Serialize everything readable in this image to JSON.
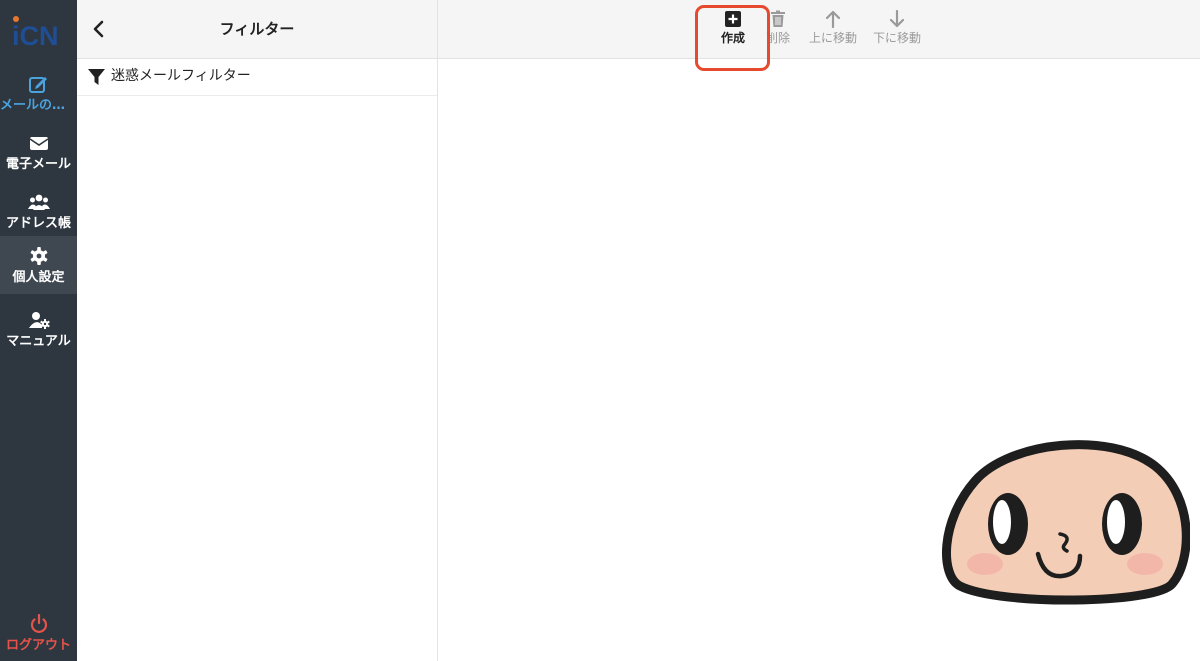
{
  "app": {
    "logo_text": "iCN"
  },
  "nav": {
    "items": [
      {
        "label": "メールの作成",
        "icon": "edit-icon"
      },
      {
        "label": "電子メール",
        "icon": "envelope-icon"
      },
      {
        "label": "アドレス帳",
        "icon": "users-icon"
      },
      {
        "label": "個人設定",
        "icon": "gear-icon"
      },
      {
        "label": "マニュアル",
        "icon": "user-gear-icon"
      }
    ],
    "logout_label": "ログアウト"
  },
  "filters_panel": {
    "title": "フィルター",
    "items": [
      {
        "label": "迷惑メールフィルター",
        "icon": "funnel-icon"
      }
    ]
  },
  "toolbar": {
    "create_label": "作成",
    "delete_label": "削除",
    "move_up_label": "上に移動",
    "move_down_label": "下に移動"
  },
  "colors": {
    "nav_bg": "#2e3740",
    "nav_active": "#3f4851",
    "accent_blue": "#4aa3df",
    "logout_red": "#e5534b",
    "highlight_red": "#e64a2e"
  }
}
